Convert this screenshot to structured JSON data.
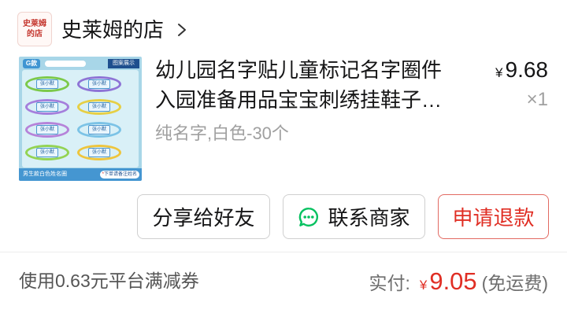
{
  "shop": {
    "logo_line1": "史莱姆",
    "logo_line2": "的店",
    "name": "史莱姆的店",
    "chevron_icon": "chevron-right-icon"
  },
  "product": {
    "title_line1": "幼儿园名字贴儿童标记名字圈件",
    "title_line2": "入园准备用品宝宝刺绣挂鞋子…",
    "price_currency": "¥",
    "price": "9.68",
    "quantity": "×1",
    "sku": "纯名字,白色-30个",
    "image": {
      "badge": "G款",
      "showcase_label": "图案展示",
      "footer_label": "男生款白色姓名圈",
      "note_mark": "*",
      "note_label": "下单请备注姓名",
      "tags": [
        {
          "label": "张小默",
          "loop_color": "#7cc94a"
        },
        {
          "label": "张小默",
          "loop_color": "#8e74d6"
        },
        {
          "label": "张小默",
          "loop_color": "#a57fdc"
        },
        {
          "label": "张小默",
          "loop_color": "#e6cf45"
        },
        {
          "label": "张小默",
          "loop_color": "#b683d9"
        },
        {
          "label": "张小默",
          "loop_color": "#7cc3e6"
        },
        {
          "label": "张小默",
          "loop_color": "#93d353"
        },
        {
          "label": "张小默",
          "loop_color": "#eec53d"
        }
      ]
    }
  },
  "actions": {
    "share_label": "分享给好友",
    "contact_label": "联系商家",
    "contact_icon": "chat-bubble-icon",
    "refund_label": "申请退款"
  },
  "summary": {
    "coupon_text": "使用0.63元平台满减券",
    "paid_label": "实付:",
    "paid_currency": "¥",
    "paid_amount": "9.05",
    "shipping_note": "(免运费)"
  },
  "colors": {
    "accent_red": "#e02e24",
    "contact_green": "#07c160",
    "text_primary": "#151516",
    "text_secondary": "#a0a0a0"
  }
}
